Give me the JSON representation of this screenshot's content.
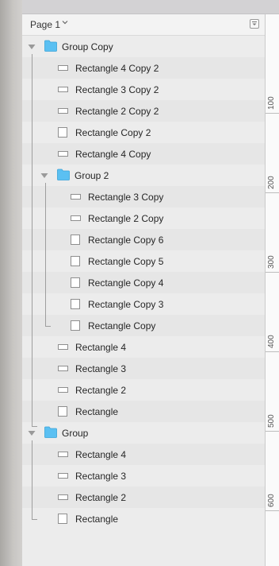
{
  "header": {
    "page_label": "Page 1"
  },
  "layers": [
    {
      "label": "Group Copy",
      "icon": "folder-icon",
      "kind": "group",
      "depth": 0
    },
    {
      "label": "Rectangle 4 Copy 2",
      "icon": "rectangle-icon",
      "kind": "rect",
      "depth": 1
    },
    {
      "label": "Rectangle 3 Copy 2",
      "icon": "rectangle-icon",
      "kind": "rect",
      "depth": 1
    },
    {
      "label": "Rectangle 2 Copy 2",
      "icon": "rectangle-icon",
      "kind": "rect",
      "depth": 1
    },
    {
      "label": "Rectangle Copy 2",
      "icon": "square-icon",
      "kind": "square",
      "depth": 1
    },
    {
      "label": "Rectangle 4 Copy",
      "icon": "rectangle-icon",
      "kind": "rect",
      "depth": 1
    },
    {
      "label": "Group 2",
      "icon": "folder-icon",
      "kind": "group",
      "depth": 1
    },
    {
      "label": "Rectangle 3 Copy",
      "icon": "rectangle-icon",
      "kind": "rect",
      "depth": 2
    },
    {
      "label": "Rectangle 2 Copy",
      "icon": "rectangle-icon",
      "kind": "rect",
      "depth": 2
    },
    {
      "label": "Rectangle Copy 6",
      "icon": "square-icon",
      "kind": "square",
      "depth": 2
    },
    {
      "label": "Rectangle Copy 5",
      "icon": "square-icon",
      "kind": "square",
      "depth": 2
    },
    {
      "label": "Rectangle Copy 4",
      "icon": "square-icon",
      "kind": "square",
      "depth": 2
    },
    {
      "label": "Rectangle Copy 3",
      "icon": "square-icon",
      "kind": "square",
      "depth": 2
    },
    {
      "label": "Rectangle Copy",
      "icon": "square-icon",
      "kind": "square",
      "depth": 2
    },
    {
      "label": "Rectangle 4",
      "icon": "rectangle-icon",
      "kind": "rect",
      "depth": 1
    },
    {
      "label": "Rectangle 3",
      "icon": "rectangle-icon",
      "kind": "rect",
      "depth": 1
    },
    {
      "label": "Rectangle 2",
      "icon": "rectangle-icon",
      "kind": "rect",
      "depth": 1
    },
    {
      "label": "Rectangle",
      "icon": "square-icon",
      "kind": "square",
      "depth": 1
    },
    {
      "label": "Group",
      "icon": "folder-icon",
      "kind": "group",
      "depth": 0
    },
    {
      "label": "Rectangle 4",
      "icon": "rectangle-icon",
      "kind": "rect",
      "depth": 1
    },
    {
      "label": "Rectangle 3",
      "icon": "rectangle-icon",
      "kind": "rect",
      "depth": 1
    },
    {
      "label": "Rectangle 2",
      "icon": "rectangle-icon",
      "kind": "rect",
      "depth": 1
    },
    {
      "label": "Rectangle",
      "icon": "square-icon",
      "kind": "square",
      "depth": 1
    }
  ],
  "ruler": {
    "labels": [
      "100",
      "200",
      "300",
      "400",
      "500",
      "600"
    ]
  },
  "colors": {
    "folder": "#5bc0f2",
    "panel_bg": "#ececec",
    "row_alt": "#e6e6e6"
  }
}
